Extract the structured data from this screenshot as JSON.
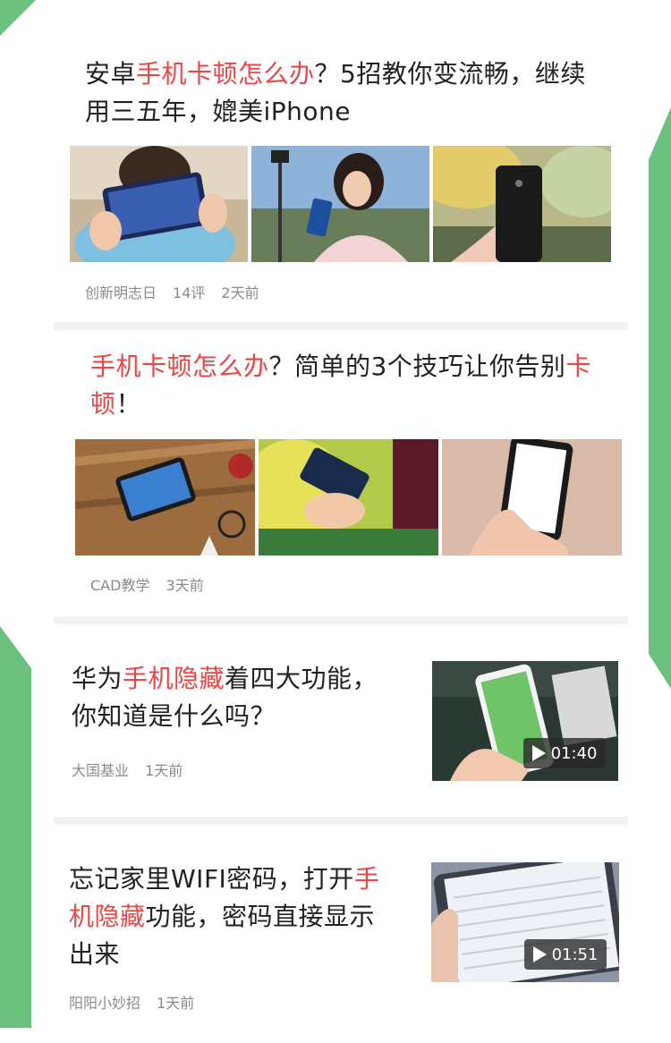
{
  "colors": {
    "accent_green": "#6cc07d",
    "highlight_red": "#ef4444"
  },
  "articles": [
    {
      "title_segments": [
        {
          "text": "安卓",
          "hl": false
        },
        {
          "text": "手机卡顿怎么办",
          "hl": true
        },
        {
          "text": "？5招教你变流畅，继续用三五年，媲美iPhone",
          "hl": false
        }
      ],
      "source": "创新明志日",
      "comments": "14评",
      "time": "2天前",
      "images": [
        "woman-holding-phone",
        "woman-with-phone-outdoors",
        "hand-holding-iphone"
      ]
    },
    {
      "title_segments": [
        {
          "text": "手机卡顿怎么办",
          "hl": true
        },
        {
          "text": "？简单的3个技巧让你告别",
          "hl": false
        },
        {
          "text": "卡顿",
          "hl": true
        },
        {
          "text": "！",
          "hl": false
        }
      ],
      "source": "CAD教学",
      "time": "3天前",
      "images": [
        "phone-on-desk",
        "hand-with-phone-green",
        "hand-holding-phone-white-screen"
      ]
    },
    {
      "title_segments": [
        {
          "text": "华为",
          "hl": false
        },
        {
          "text": "手机隐藏",
          "hl": true
        },
        {
          "text": "着四大功能，你知道是什么吗？",
          "hl": false
        }
      ],
      "source": "大国基业",
      "time": "1天前",
      "video_duration": "01:40",
      "images": [
        "huawei-phone-video"
      ]
    },
    {
      "title_segments": [
        {
          "text": "忘记家里WIFI密码，打开",
          "hl": false
        },
        {
          "text": "手机隐藏",
          "hl": true
        },
        {
          "text": "功能，密码直接显示出来",
          "hl": false
        }
      ],
      "source": "阳阳小妙招",
      "time": "1天前",
      "video_duration": "01:51",
      "images": [
        "wifi-settings-video"
      ]
    }
  ]
}
